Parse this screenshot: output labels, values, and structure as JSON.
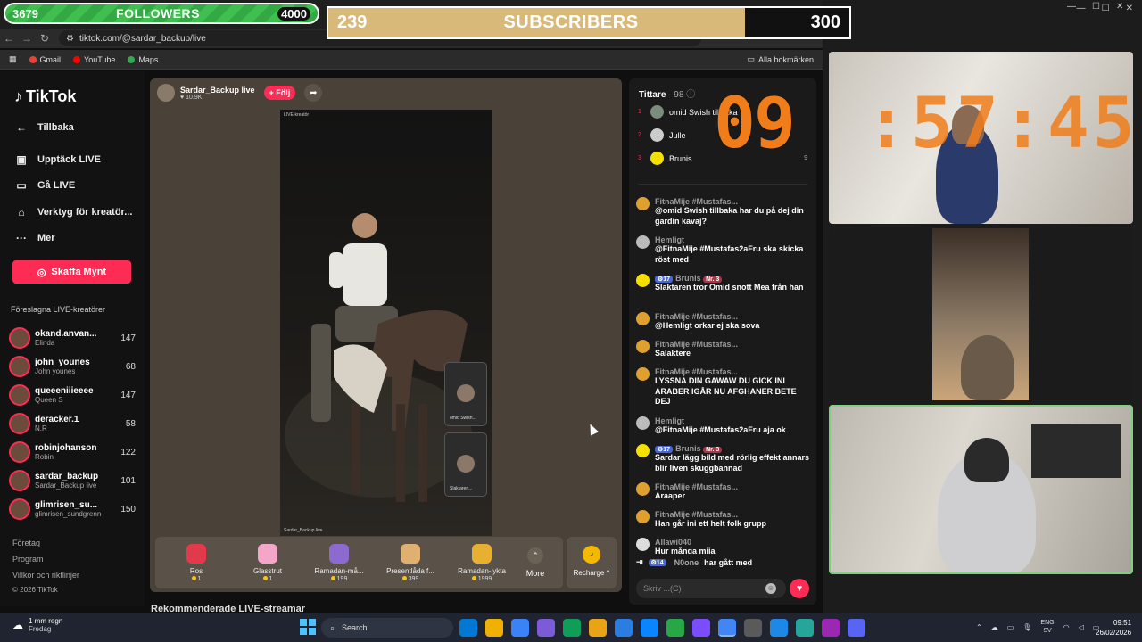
{
  "overlays": {
    "followers": {
      "current": "3679",
      "label": "FOLLOWERS",
      "goal": "4000",
      "progress": 0.92
    },
    "subscribers": {
      "current": "239",
      "label": "SUBSCRIBERS",
      "goal": "300",
      "progress": 0.8
    },
    "timer": {
      "hours": "09",
      "rest": ":57:45"
    }
  },
  "browser": {
    "url": "tiktok.com/@sardar_backup/live",
    "bookmarks": [
      "Gmail",
      "YouTube",
      "Maps"
    ],
    "bookmarks_all": "Alla bokmärken"
  },
  "sidebar": {
    "logo": "TikTok",
    "back": "Tillbaka",
    "items": [
      "Upptäck LIVE",
      "Gå LIVE",
      "Verktyg för kreatör...",
      "Mer"
    ],
    "coins_button": "Skaffa Mynt",
    "suggested_title": "Föreslagna LIVE-kreatörer",
    "creators": [
      {
        "name": "okand.anvan...",
        "sub": "Elinda",
        "count": "147"
      },
      {
        "name": "john_younes",
        "sub": "John younes",
        "count": "68"
      },
      {
        "name": "queeeniiieeee",
        "sub": "Queen S",
        "count": "147"
      },
      {
        "name": "deracker.1",
        "sub": "N.R",
        "count": "58"
      },
      {
        "name": "robinjohanson",
        "sub": "Robin",
        "count": "122"
      },
      {
        "name": "sardar_backup",
        "sub": "Sardar_Backup live",
        "count": "101"
      },
      {
        "name": "glimrisen_su...",
        "sub": "glimrisen_sundgrenn",
        "count": "150"
      }
    ],
    "footer": [
      "Företag",
      "Program",
      "Villkor och riktlinjer",
      "© 2026 TikTok"
    ]
  },
  "stream": {
    "host_name": "Sardar_Backup live",
    "host_likes": "10.9K",
    "follow_label": "+ Följ",
    "video_label_top": "LIVE-kreatör",
    "video_label_bottom": "Sardar_Backup live",
    "pips": [
      "omid Swish...",
      "Slaktaren..."
    ],
    "gifts": [
      {
        "name": "Ros",
        "price": "1",
        "color": "#e23a4a"
      },
      {
        "name": "Glasstrut",
        "price": "1",
        "color": "#f3a6c8"
      },
      {
        "name": "Ramadan-må...",
        "price": "199",
        "color": "#8c6ad0"
      },
      {
        "name": "Presentlåda f...",
        "price": "399",
        "color": "#e0b070"
      },
      {
        "name": "Ramadan-lykta",
        "price": "1999",
        "color": "#e8b030"
      }
    ],
    "more_label": "More",
    "recharge_label": "Recharge ^",
    "recommended": "Rekommenderade LIVE-streamar"
  },
  "chat": {
    "viewers_label": "Tittare",
    "viewers_count": "· 98",
    "top_viewers": [
      {
        "rank": "1",
        "name": "omid Swish tillbaka",
        "score": "",
        "color": "#7a8c7a"
      },
      {
        "rank": "2",
        "name": "Julle",
        "score": "",
        "color": "#cccccc"
      },
      {
        "rank": "3",
        "name": "Brunis",
        "score": "9",
        "color": "#f5e000"
      }
    ],
    "messages": [
      {
        "user": "FitnaMije #Mustafas...",
        "text": "@omid Swish tillbaka har du på dej din gardin kavaj?",
        "color": "#e0a030"
      },
      {
        "user": "Hemligt",
        "text": "@FitnaMije #Mustafas2aFru ska skicka röst med",
        "color": "#bbbbbb"
      },
      {
        "user": "Brunis",
        "text": "Slaktaren tror Omid snott Mea från han",
        "color": "#f5e000",
        "lvl": "17",
        "nr": "Nr. 3"
      },
      {
        "user": "FitnaMije #Mustafas...",
        "text": "@Hemligt orkar ej ska sova",
        "color": "#e0a030"
      },
      {
        "user": "FitnaMije #Mustafas...",
        "text": "Salaktere",
        "color": "#e0a030"
      },
      {
        "user": "FitnaMije #Mustafas...",
        "text": "LYSSNA DIN GAWAW DU GICK INI ARABER IGÅR NU AFGHANER BETE DEJ",
        "color": "#e0a030"
      },
      {
        "user": "Hemligt",
        "text": "@FitnaMije #Mustafas2aFru aja ok",
        "color": "#bbbbbb"
      },
      {
        "user": "Brunis",
        "text": "Sardar lägg bild med rörlig effekt annars blir liven skuggbannad",
        "color": "#f5e000",
        "lvl": "17",
        "nr": "Nr. 3"
      },
      {
        "user": "FitnaMije #Mustafas...",
        "text": "Araaper",
        "color": "#e0a030"
      },
      {
        "user": "FitnaMije #Mustafas...",
        "text": "Han går ini ett helt folk grupp",
        "color": "#e0a030"
      },
      {
        "user": "Allawi040",
        "text": "Hur många mija",
        "color": "#dddddd"
      }
    ],
    "join": {
      "level": "14",
      "user": "N0one",
      "text": "har gått med"
    },
    "input_placeholder": "Skriv ...(C)"
  },
  "taskbar": {
    "weather_line1": "1 mm regn",
    "weather_line2": "Fredag",
    "search": "Search",
    "lang": "ENG",
    "region": "SV",
    "time": "09:51",
    "date": "26/02/2026",
    "icons": [
      "#0078d4",
      "#f0b000",
      "#3b82f6",
      "#7b5cd6",
      "#d04030",
      "#27a745",
      "#2a7de1",
      "#0a84ff",
      "#e34c26",
      "#5a5a5a",
      "#0f9d58",
      "#4285f4",
      "#1e88e5",
      "#9c27b0",
      "#5865f2"
    ]
  }
}
